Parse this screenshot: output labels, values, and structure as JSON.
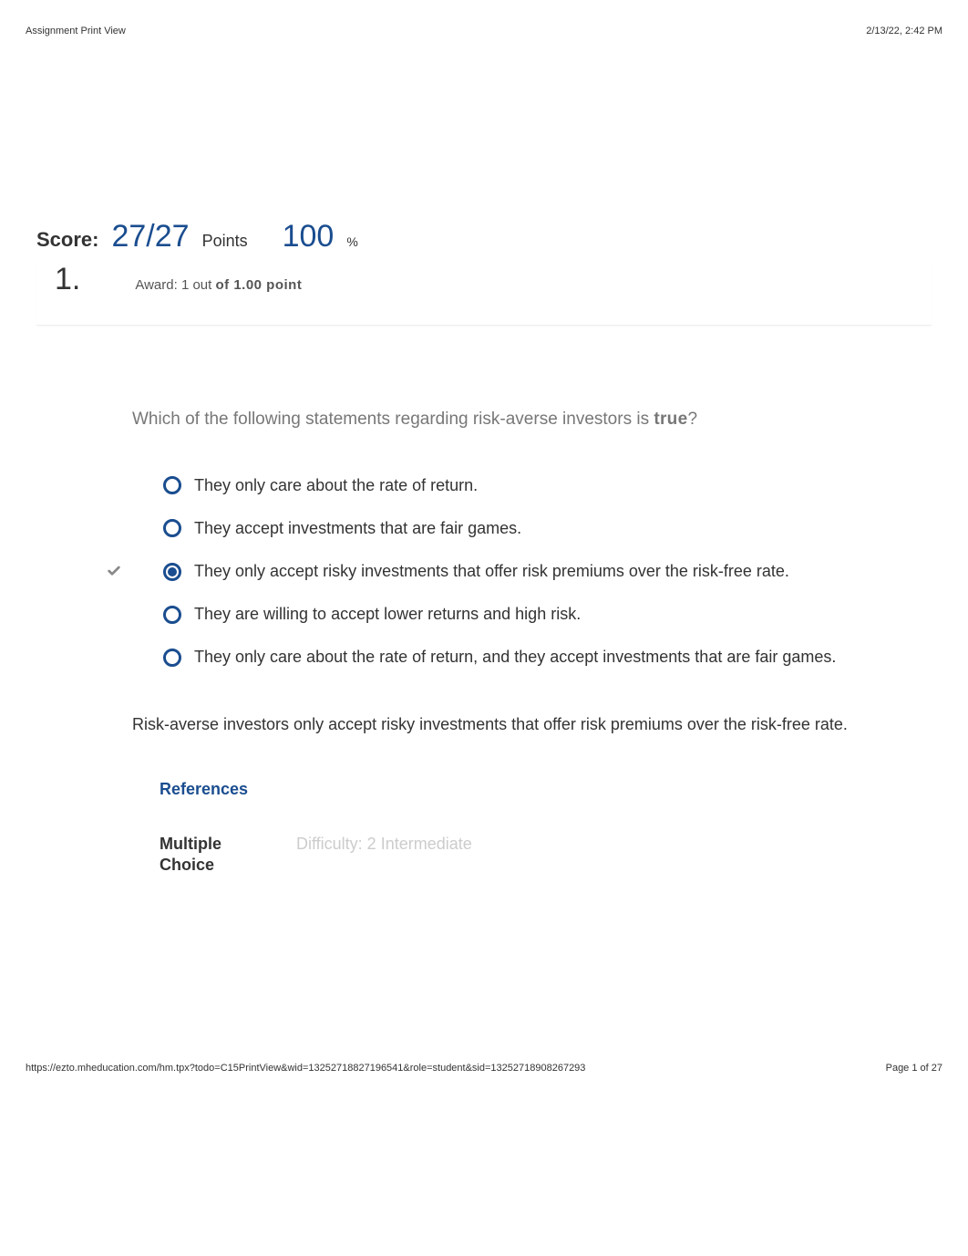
{
  "header": {
    "title": "Assignment Print View",
    "datetime": "2/13/22, 2:42 PM"
  },
  "score": {
    "label": "Score:",
    "value": "27/27",
    "points_label": "Points",
    "percent": "100",
    "percent_sign": "%"
  },
  "question": {
    "number": "1.",
    "award_label": "Award:",
    "award_earned": "1 out",
    "award_of": "of 1.00 point",
    "text_prefix": "Which of the following statements regarding risk-averse investors is ",
    "text_bold": "true",
    "text_suffix": "?",
    "options": [
      {
        "label": "They only care about the rate of return.",
        "selected": false,
        "correct": false
      },
      {
        "label": "They accept investments that are fair games.",
        "selected": false,
        "correct": false
      },
      {
        "label": "They only accept risky investments that offer risk premiums over the risk-free rate.",
        "selected": true,
        "correct": true
      },
      {
        "label": "They are willing to accept lower returns and high risk.",
        "selected": false,
        "correct": false
      },
      {
        "label": "They only care about the rate of return, and they accept investments that are fair games.",
        "selected": false,
        "correct": false
      }
    ],
    "explanation": "Risk-averse investors only accept risky investments that offer risk premiums over the risk-free rate."
  },
  "references": {
    "heading": "References",
    "type": "Multiple Choice",
    "difficulty": "Difficulty: 2 Intermediate"
  },
  "footer": {
    "url": "https://ezto.mheducation.com/hm.tpx?todo=C15PrintView&wid=13252718827196541&role=student&sid=13252718908267293",
    "page": "Page 1 of 27"
  }
}
